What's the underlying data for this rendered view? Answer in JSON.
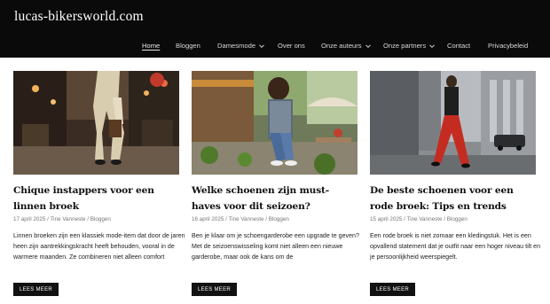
{
  "site": {
    "title": "lucas-bikersworld.com"
  },
  "nav": [
    {
      "label": "Home",
      "active": true,
      "dropdown": false
    },
    {
      "label": "Bloggen",
      "active": false,
      "dropdown": false
    },
    {
      "label": "Damesmode",
      "active": false,
      "dropdown": true
    },
    {
      "label": "Over ons",
      "active": false,
      "dropdown": false
    },
    {
      "label": "Onze auteurs",
      "active": false,
      "dropdown": true
    },
    {
      "label": "Onze partners",
      "active": false,
      "dropdown": true
    },
    {
      "label": "Contact",
      "active": false,
      "dropdown": false
    },
    {
      "label": "Privacybeleid",
      "active": false,
      "dropdown": false
    }
  ],
  "posts": [
    {
      "title": "Chique instappers voor een linnen broek",
      "date": "17 april 2025",
      "author": "Tine Vanneste",
      "category": "Bloggen",
      "excerpt": "Linnen broeken zijn een klassiek mode-item dat door de jaren heen zijn aantrekkingskracht heeft behouden, vooral in de warmere maanden. Ze combineren niet alleen comfort",
      "button": "LEES MEER"
    },
    {
      "title": "Welke schoenen zijn must-haves voor dit seizoen?",
      "date": "16 april 2025",
      "author": "Tine Vanneste",
      "category": "Bloggen",
      "excerpt": "Ben je klaar om je schoengarderobe een upgrade te geven? Met de seizoenswisseling komt niet alleen een nieuwe garderobe, maar ook de kans om de",
      "button": "LEES MEER"
    },
    {
      "title": "De beste schoenen voor een rode broek: Tips en trends",
      "date": "15 april 2025",
      "author": "Tine Vanneste",
      "category": "Bloggen",
      "excerpt": "Een rode broek is niet zomaar een kledingstuk. Het is een opvallend statement dat je outfit naar een hoger niveau tilt en je persoonlijkheid weerspiegelt.",
      "button": "LEES MEER"
    }
  ],
  "meta_separator": " / "
}
